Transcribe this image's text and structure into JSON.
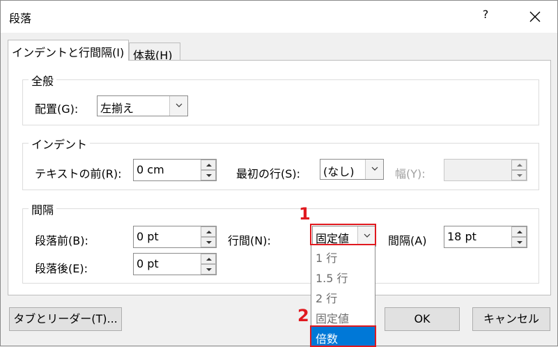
{
  "window": {
    "title": "段落",
    "help": "?"
  },
  "tabs": [
    {
      "label": "インデントと行間隔(I)"
    },
    {
      "label": "体裁(H)"
    }
  ],
  "general": {
    "group_label": "全般",
    "alignment_label": "配置(G):",
    "alignment_value": "左揃え"
  },
  "indent": {
    "group_label": "インデント",
    "before_text_label": "テキストの前(R):",
    "before_text_value": "0 cm",
    "special_label": "最初の行(S):",
    "special_value": "(なし)",
    "by_label": "幅(Y):",
    "by_value": ""
  },
  "spacing": {
    "group_label": "間隔",
    "before_label": "段落前(B):",
    "before_value": "0 pt",
    "after_label": "段落後(E):",
    "after_value": "0 pt",
    "line_label": "行間(N):",
    "line_value": "固定値",
    "at_label": "間隔(A)",
    "at_value": "18 pt",
    "line_options": [
      "1 行",
      "1.5 行",
      "2 行",
      "固定値",
      "倍数"
    ],
    "selected_option": "倍数"
  },
  "buttons": {
    "tabs_label": "タブとリーダー(T)...",
    "ok_label": "OK",
    "cancel_label": "キャンセル"
  },
  "annotations": {
    "step1": "1",
    "step2": "2",
    "color": "#e0191f"
  },
  "icons": [
    "close-icon",
    "chevron-down-icon",
    "spin-up-icon",
    "spin-down-icon"
  ]
}
